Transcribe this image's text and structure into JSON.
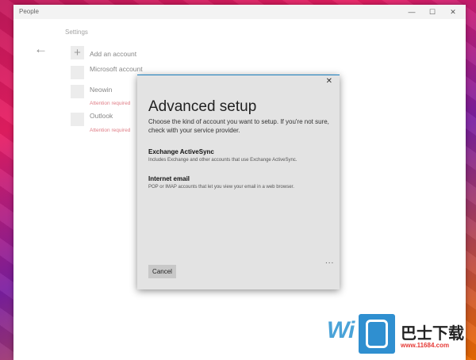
{
  "window": {
    "app_title": "People",
    "controls": [
      "—",
      "☐",
      "✕"
    ]
  },
  "nav": {
    "back_icon": "←",
    "section_label": "Settings"
  },
  "accounts": [
    {
      "name": "Add an account",
      "icon": "+"
    },
    {
      "name": "Microsoft account"
    },
    {
      "name": "Neowin",
      "status": "Attention required"
    },
    {
      "name": "Outlook",
      "status": "Attention required"
    }
  ],
  "dialog": {
    "close_icon": "✕",
    "title": "Advanced setup",
    "description": "Choose the kind of account you want to setup. If you're not sure, check with your service provider.",
    "options": [
      {
        "title": "Exchange ActiveSync",
        "description": "Includes Exchange and other accounts that use Exchange ActiveSync."
      },
      {
        "title": "Internet email",
        "description": "POP or IMAP accounts that let you view your email in a web browser."
      }
    ],
    "more_icon": "...",
    "cancel_label": "Cancel"
  },
  "watermark": {
    "text": "Wi",
    "cn": "巴士下载",
    "url": "www.11684.com"
  }
}
